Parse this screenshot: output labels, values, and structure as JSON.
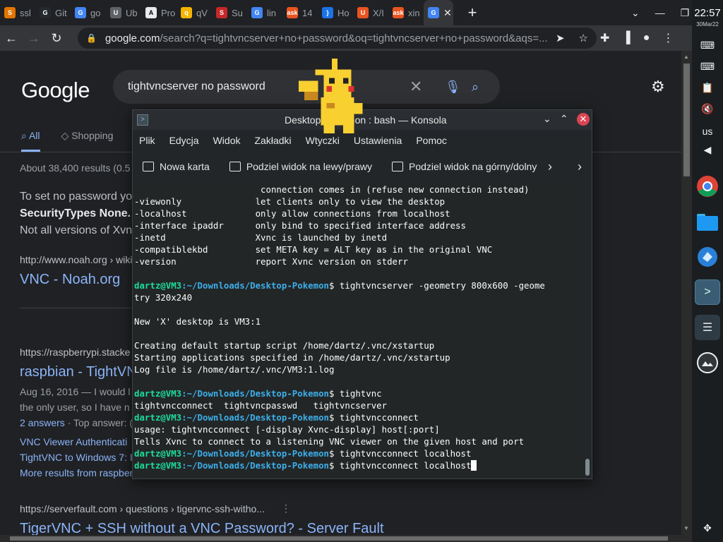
{
  "browser": {
    "tabs": [
      {
        "label": "ssl",
        "color": "#e37400",
        "glyph": "S"
      },
      {
        "label": "Git",
        "color": "#24292e",
        "glyph": "G"
      },
      {
        "label": "go",
        "color": "#4285f4",
        "glyph": "G"
      },
      {
        "label": "Ub",
        "color": "#5f6368",
        "glyph": "U"
      },
      {
        "label": "Pro",
        "color": "#e8eaed",
        "glyph": "A"
      },
      {
        "label": "qV",
        "color": "#f4b400",
        "glyph": "q"
      },
      {
        "label": "Su",
        "color": "#c62828",
        "glyph": "S"
      },
      {
        "label": "lin",
        "color": "#4285f4",
        "glyph": "G"
      },
      {
        "label": "14",
        "color": "#e95420",
        "glyph": "ask"
      },
      {
        "label": "Ho",
        "color": "#1a73e8",
        "glyph": "}"
      },
      {
        "label": "X/I",
        "color": "#e95420",
        "glyph": "U"
      },
      {
        "label": "xin",
        "color": "#e95420",
        "glyph": "ask"
      }
    ],
    "active_tab_close": "✕",
    "new_tab": "+",
    "url_host": "google.com",
    "url_rest": "/search?q=tightvncserver+no+password&oq=tightvncserver+no+password&aqs=..."
  },
  "google": {
    "logo": "Google",
    "query": "tightvncserver no password",
    "tabs": [
      "All",
      "Shopping"
    ],
    "result_count": "About 38,400 results (0.5",
    "snippet": [
      "To set no password yo",
      "SecurityTypes None. T",
      "Not all versions of Xvn"
    ],
    "results": [
      {
        "url": "http://www.noah.org › wiki",
        "title": "VNC - Noah.org"
      },
      {
        "url": "https://raspberrypi.stacke",
        "title": "raspbian - TightVN",
        "meta": "Aug 16, 2016 — I would l",
        "meta2": "the only user, so I have n",
        "answers": "2 answers",
        "top": "· Top answer: (",
        "links": [
          "VNC Viewer Authenticati",
          "TightVNC to Windows 7: I",
          "More results from raspber"
        ]
      },
      {
        "url": "https://serverfault.com › questions › tigervnc-ssh-witho...",
        "title": "TigerVNC + SSH without a VNC Password? - Server Fault"
      }
    ]
  },
  "system": {
    "time": "22:57",
    "date": "30Mar22",
    "lang": "us"
  },
  "konsole": {
    "title": "Desktop-Pokemon : bash — Konsola",
    "menu": [
      "Plik",
      "Edycja",
      "Widok",
      "Zakładki",
      "Wtyczki",
      "Ustawienia",
      "Pomoc"
    ],
    "tools": [
      "Nowa karta",
      "Podziel widok na lewy/prawy",
      "Podziel widok na górny/dolny"
    ],
    "user": "dartz@VM3",
    "path": ":~/Downloads/Desktop-Pokemon",
    "lines_top": [
      "                        connection comes in (refuse new connection instead)",
      "-viewonly              let clients only to view the desktop",
      "-localhost             only allow connections from localhost",
      "-interface ipaddr      only bind to specified interface address",
      "-inetd                 Xvnc is launched by inetd",
      "-compatiblekbd         set META key = ALT key as in the original VNC",
      "-version               report Xvnc version on stderr",
      ""
    ],
    "cmd1": "$ tightvncserver -geometry 800x600 -geome",
    "out1": [
      "try 320x240",
      "",
      "New 'X' desktop is VM3:1",
      "",
      "Creating default startup script /home/dartz/.vnc/xstartup",
      "Starting applications specified in /home/dartz/.vnc/xstartup",
      "Log file is /home/dartz/.vnc/VM3:1.log",
      ""
    ],
    "cmd2": "$ tightvnc",
    "out2": "tightvncconnect  tightvncpasswd   tightvncserver",
    "cmd3": "$ tightvncconnect",
    "out3": [
      "usage: tightvncconnect [-display Xvnc-display] host[:port]",
      "Tells Xvnc to connect to a listening VNC viewer on the given host and port"
    ],
    "cmd4": "$ tightvncconnect localhost",
    "cmd5": "$ tightvncconnect localhost"
  },
  "colors": {
    "prompt_user": "#1cdc9a",
    "prompt_path": "#3daee9",
    "link": "#8ab4f8",
    "close": "#da4453"
  }
}
